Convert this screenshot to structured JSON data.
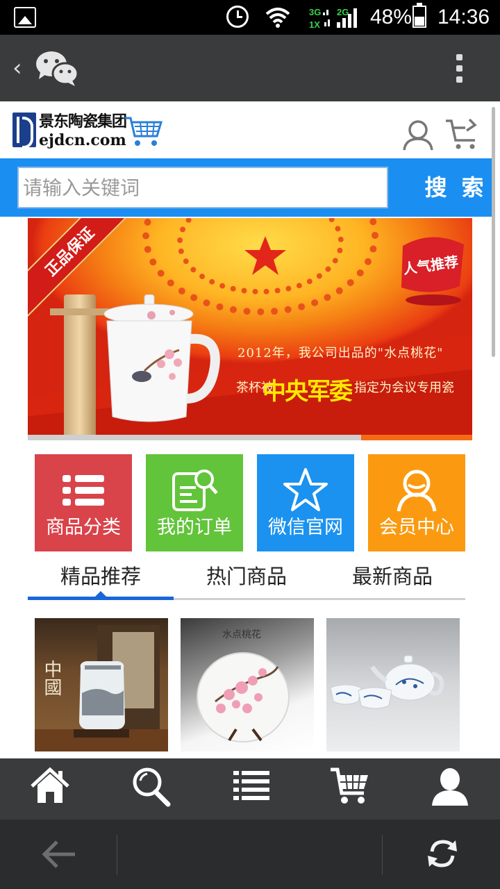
{
  "status_bar": {
    "battery": "48%",
    "time": "14:36",
    "net1": "3G",
    "net2": "1X",
    "net3": "2G"
  },
  "header": {
    "logo_cn": "景东陶瓷集团",
    "logo_en": "ejdcn.com"
  },
  "search": {
    "placeholder": "请输入关键词",
    "button_label": "搜 索"
  },
  "banner": {
    "ribbon": "正品保证",
    "badge": "人气推荐",
    "line1": "2012年，我公司出品的\"水点桃花\"",
    "line2_pre": "茶杯被",
    "line2_highlight": "中央军委",
    "line2_post": "指定为会议专用瓷",
    "slide_progress": 0.25
  },
  "tiles": [
    {
      "label": "商品分类",
      "icon": "list-icon",
      "color": "#d9434a"
    },
    {
      "label": "我的订单",
      "icon": "order-search-icon",
      "color": "#62c43a"
    },
    {
      "label": "微信官网",
      "icon": "star-icon",
      "color": "#1b92ef"
    },
    {
      "label": "会员中心",
      "icon": "member-icon",
      "color": "#fb9a10"
    }
  ],
  "tabs": [
    {
      "label": "精品推荐",
      "active": true
    },
    {
      "label": "热门商品",
      "active": false
    },
    {
      "label": "最新商品",
      "active": false
    }
  ],
  "products": [
    {
      "caption": "中國"
    },
    {
      "caption": "水点桃花"
    },
    {
      "caption": ""
    }
  ],
  "bottom_nav": [
    "home-icon",
    "search-icon",
    "menu-list-icon",
    "cart-icon",
    "user-icon"
  ],
  "colors": {
    "search_bar": "#1a8ff1",
    "tab_active": "#1a66d9",
    "toolbar": "#3a3b3d"
  }
}
